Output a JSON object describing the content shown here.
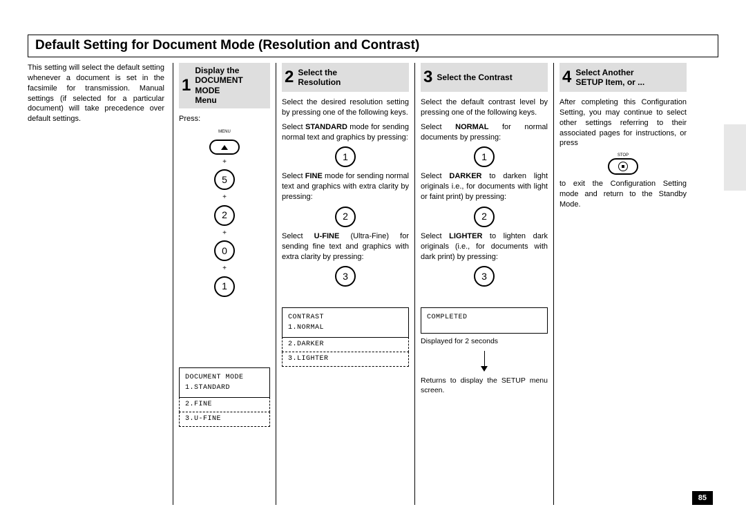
{
  "page_number": "85",
  "title": "Default Setting for Document Mode (Resolution and Contrast)",
  "intro": "This setting will select the default setting whenever a document is set in the facsimile for transmission. Manual settings (if selected for a particular document) will take precedence over default settings.",
  "steps": {
    "s1": {
      "num": "1",
      "title": "Display the\nDOCUMENT MODE\nMenu",
      "press": "Press:",
      "menu_label": "MENU",
      "keys": {
        "k1": "5",
        "k2": "2",
        "k3": "0",
        "k4": "1"
      },
      "lcd": {
        "l1": "DOCUMENT MODE",
        "l2": "1.STANDARD",
        "d1": "2.FINE",
        "d2": "3.U-FINE"
      }
    },
    "s2": {
      "num": "2",
      "title": "Select the\nResolution",
      "p1": "Select the desired resolution setting by pressing one of the following keys.",
      "p2a": "Select ",
      "p2b": "STANDARD",
      "p2c": " mode for sending normal text and graphics by pressing:",
      "k1": "1",
      "p3a": "Select ",
      "p3b": "FINE",
      "p3c": " mode for sending normal text and graphics with extra clarity by pressing:",
      "k2": "2",
      "p4a": "Select ",
      "p4b": "U-FINE",
      "p4c": " (Ultra-Fine) for sending fine text and graphics with extra clarity by pressing:",
      "k3": "3",
      "lcd": {
        "l1": "CONTRAST",
        "l2": "1.NORMAL",
        "d1": "2.DARKER",
        "d2": "3.LIGHTER"
      }
    },
    "s3": {
      "num": "3",
      "title": "Select the Contrast",
      "p1": "Select the default contrast level by pressing one of the following keys.",
      "p2a": "Select ",
      "p2b": "NORMAL",
      "p2c": " for normal documents by pressing:",
      "k1": "1",
      "p3a": "Select ",
      "p3b": "DARKER",
      "p3c": " to darken light originals i.e., for documents with light or faint print) by pressing:",
      "k2": "2",
      "p4a": "Select ",
      "p4b": "LIGHTER",
      "p4c": " to lighten dark originals (i.e., for documents with dark print) by pressing:",
      "k3": "3",
      "lcd": {
        "l1": "COMPLETED"
      },
      "disp_note": "Displayed for 2 seconds",
      "returns": "Returns to display the SETUP menu screen."
    },
    "s4": {
      "num": "4",
      "title": "Select Another\nSETUP Item, or ...",
      "p1": "After completing this Configuration Setting, you may continue to select other settings referring to their associated pages for instructions, or press",
      "stop_label": "STOP",
      "p2": "to exit the Configuration Setting mode and return to the Standby Mode."
    }
  }
}
